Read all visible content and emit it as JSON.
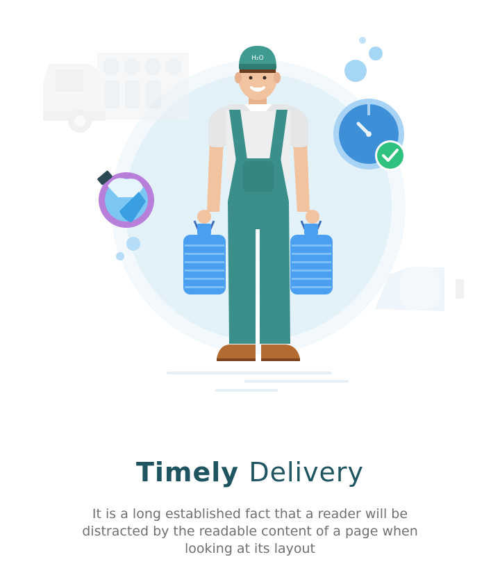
{
  "illustration": {
    "cap_label": "H₂O",
    "colors": {
      "teal": "#3b8f8a",
      "cap": "#3f9a8f",
      "bottle": "#4a9ff0",
      "halo": "#e3f1f9",
      "check": "#2ec27e",
      "clock": "#3d8fd8",
      "globe": "#b77fd9",
      "boots": "#b46b32"
    },
    "icons": [
      "delivery-truck-icon",
      "stopwatch-icon",
      "check-badge-icon",
      "globe-icon",
      "water-bottle-icon",
      "delivery-van-icon"
    ]
  },
  "heading": {
    "bold": "Timely",
    "light": "Delivery"
  },
  "description": "It is a long established fact that a reader will be distracted by the readable content of a page when looking at its layout"
}
